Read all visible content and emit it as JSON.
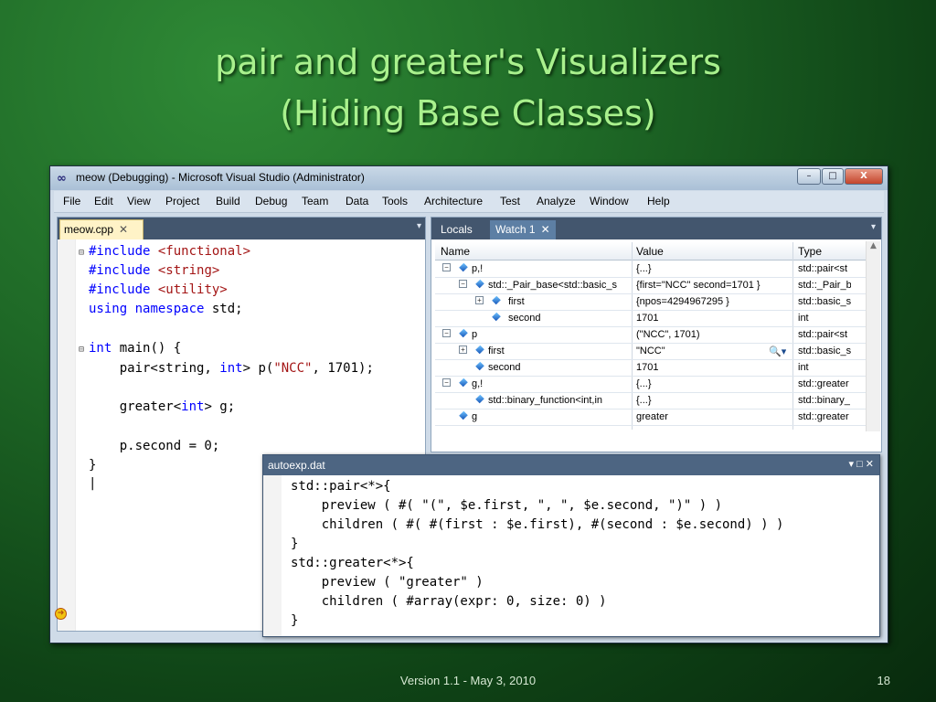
{
  "slide": {
    "title_line1": "pair and greater's Visualizers",
    "title_line2": "(Hiding Base Classes)",
    "footer": "Version 1.1 - May 3, 2010",
    "page_number": "18"
  },
  "window": {
    "title": "meow (Debugging) - Microsoft Visual Studio (Administrator)",
    "logo_icon": "infinity-icon",
    "controls": {
      "minimize": "–",
      "maximize": "□",
      "close": "X"
    }
  },
  "menu": [
    "File",
    "Edit",
    "View",
    "Project",
    "Build",
    "Debug",
    "Team",
    "Data",
    "Tools",
    "Architecture",
    "Test",
    "Analyze",
    "Window",
    "Help"
  ],
  "editor": {
    "tab_label": "meow.cpp",
    "tab_close": "✕",
    "dropdown": "▾"
  },
  "watch": {
    "tabs": [
      "Locals",
      "Watch 1"
    ],
    "tab_close": "✕",
    "dropdown": "▾",
    "columns": [
      "Name",
      "Value",
      "Type"
    ],
    "rows": [
      {
        "name": "p,!",
        "value": "{...}",
        "type": "std::pair<st"
      },
      {
        "name": "std::_Pair_base<std::basic_s",
        "value": "{first=\"NCC\" second=1701 }",
        "type": "std::_Pair_b"
      },
      {
        "name": "first",
        "value": "{npos=4294967295 }",
        "type": "std::basic_s"
      },
      {
        "name": "second",
        "value": "1701",
        "type": "int"
      },
      {
        "name": "p",
        "value": "(\"NCC\", 1701)",
        "type": "std::pair<st"
      },
      {
        "name": "first",
        "value": "\"NCC\"",
        "type": "std::basic_s"
      },
      {
        "name": "second",
        "value": "1701",
        "type": "int"
      },
      {
        "name": "g,!",
        "value": "{...}",
        "type": "std::greater"
      },
      {
        "name": "std::binary_function<int,in",
        "value": "{...}",
        "type": "std::binary_"
      },
      {
        "name": "g",
        "value": "greater",
        "type": "std::greater"
      }
    ]
  },
  "autoexp": {
    "title": "autoexp.dat",
    "controls": "▾ □ ✕"
  }
}
